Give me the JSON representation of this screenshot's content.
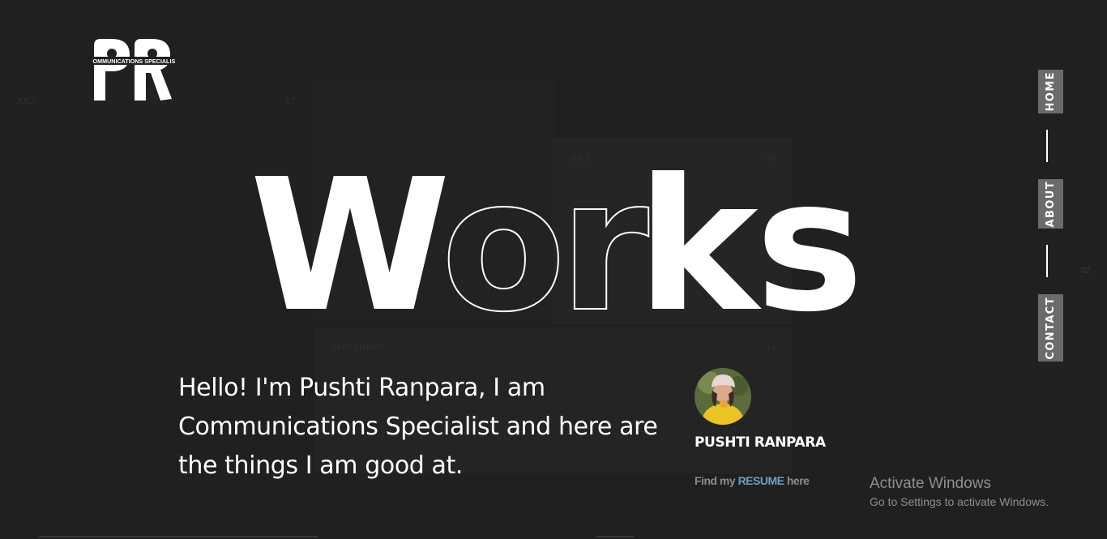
{
  "background_cards": [
    {
      "month": "JULY",
      "day": "17"
    },
    {
      "month": "JULY",
      "day": "30"
    },
    {
      "month": "SEPTEMBER",
      "day": "14"
    }
  ],
  "side_number": "02",
  "logo": {
    "letters": "PR",
    "tagline": "COMMUNICATIONS SPECIALIST"
  },
  "hero": {
    "letters": [
      "W",
      "o",
      "r",
      "k",
      "s"
    ],
    "outlined_letters": [
      "o",
      "r"
    ],
    "color": "#ffffff"
  },
  "intro": {
    "text": "Hello! I'm Pushti Ranpara, I am Communications Specialist and here are the things I am good at."
  },
  "profile": {
    "name": "PUSHTI RANPARA",
    "resume_prefix": "Find my ",
    "resume_link": "RESUME",
    "resume_suffix": " here",
    "link_color": "#6f9fc4"
  },
  "nav": {
    "items": [
      {
        "label": "HOME"
      },
      {
        "label": "ABOUT"
      },
      {
        "label": "CONTACT"
      }
    ],
    "tab_color": "#6b6b6b"
  },
  "watermark": {
    "title": "Activate Windows",
    "subtitle": "Go to Settings to activate Windows."
  },
  "colors": {
    "background": "#202020",
    "text": "#ffffff"
  }
}
